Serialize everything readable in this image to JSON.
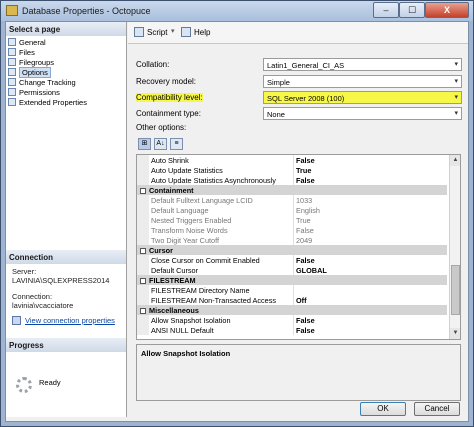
{
  "window": {
    "title": "Database Properties - Octopuce",
    "close_label": "X",
    "minimize_label": "–",
    "maximize_label": "☐"
  },
  "left": {
    "select_header": "Select a page",
    "pages": [
      {
        "label": "General",
        "selected": false
      },
      {
        "label": "Files",
        "selected": false
      },
      {
        "label": "Filegroups",
        "selected": false
      },
      {
        "label": "Options",
        "selected": true
      },
      {
        "label": "Change Tracking",
        "selected": false
      },
      {
        "label": "Permissions",
        "selected": false
      },
      {
        "label": "Extended Properties",
        "selected": false
      }
    ],
    "connection_header": "Connection",
    "server_label": "Server:",
    "server_value": "LAVINIA\\SQLEXPRESS2014",
    "connection_label": "Connection:",
    "connection_value": "lavinia\\vcacciatore",
    "view_link": "View connection properties",
    "progress_header": "Progress",
    "progress_status": "Ready"
  },
  "toolbar": {
    "script_label": "Script",
    "script_arrow": "▾",
    "help_label": "Help"
  },
  "props": {
    "collation": {
      "label": "Collation:",
      "value": "Latin1_General_CI_AS"
    },
    "recovery": {
      "label": "Recovery model:",
      "value": "Simple"
    },
    "compat": {
      "label": "Compatibility level:",
      "value": "SQL Server 2008 (100)"
    },
    "containment": {
      "label": "Containment type:",
      "value": "None"
    },
    "dropdown_arrow": "▾"
  },
  "other_options_label": "Other options:",
  "grid_toolbar": {
    "categorized": "⊞",
    "sort": "A↓",
    "pages": "≡"
  },
  "grid": [
    {
      "type": "prop",
      "name": "Auto Shrink",
      "value": "False"
    },
    {
      "type": "prop",
      "name": "Auto Update Statistics",
      "value": "True"
    },
    {
      "type": "prop",
      "name": "Auto Update Statistics Asynchronously",
      "value": "False"
    },
    {
      "type": "cat",
      "name": "Containment"
    },
    {
      "type": "dis",
      "name": "Default Fulltext Language LCID",
      "value": "1033"
    },
    {
      "type": "dis",
      "name": "Default Language",
      "value": "English"
    },
    {
      "type": "dis",
      "name": "Nested Triggers Enabled",
      "value": "True"
    },
    {
      "type": "dis",
      "name": "Transform Noise Words",
      "value": "False"
    },
    {
      "type": "dis",
      "name": "Two Digit Year Cutoff",
      "value": "2049"
    },
    {
      "type": "cat",
      "name": "Cursor"
    },
    {
      "type": "prop",
      "name": "Close Cursor on Commit Enabled",
      "value": "False"
    },
    {
      "type": "prop",
      "name": "Default Cursor",
      "value": "GLOBAL"
    },
    {
      "type": "cat",
      "name": "FILESTREAM"
    },
    {
      "type": "prop",
      "name": "FILESTREAM Directory Name",
      "value": ""
    },
    {
      "type": "prop",
      "name": "FILESTREAM Non-Transacted Access",
      "value": "Off"
    },
    {
      "type": "cat",
      "name": "Miscellaneous"
    },
    {
      "type": "prop",
      "name": "Allow Snapshot Isolation",
      "value": "False"
    },
    {
      "type": "prop",
      "name": "ANSI NULL Default",
      "value": "False"
    }
  ],
  "scroll": {
    "up": "▲",
    "down": "▼"
  },
  "description_title": "Allow Snapshot Isolation",
  "buttons": {
    "ok": "OK",
    "cancel": "Cancel"
  },
  "colors": {
    "highlight": "#f7f74a",
    "title_bar": "#a9bfdc",
    "link": "#0b47a6"
  }
}
